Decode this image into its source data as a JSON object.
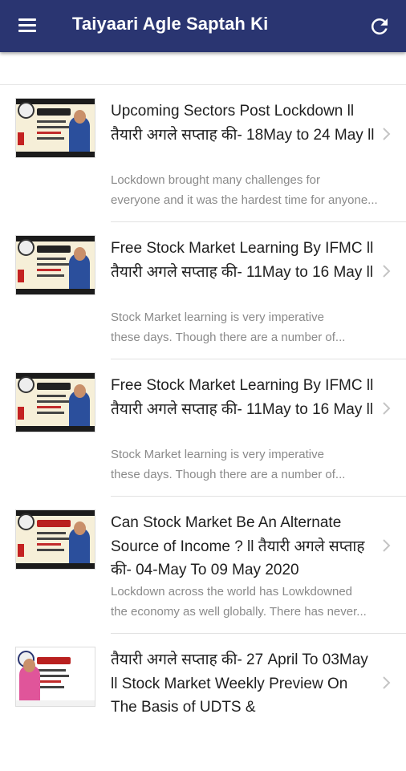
{
  "appbar": {
    "title": "Taiyaari Agle Saptah Ki",
    "menu_icon": "menu-icon",
    "refresh_icon": "refresh-icon",
    "color": "#2a3571"
  },
  "posts": [
    {
      "title": "Upcoming Sectors Post Lockdown ll तैयारी अगले सप्ताह की- 18May to 24 May ll",
      "desc_line1": "Lockdown brought many challenges for",
      "desc_line2": "everyone and it was the hardest time for anyone...",
      "thumb_icon": "video-thumbnail-icon"
    },
    {
      "title": "Free Stock Market Learning By IFMC ll तैयारी अगले सप्ताह की- 11May to 16 May ll",
      "desc_line1": "Stock Market learning is very imperative",
      "desc_line2": "these days. Though there are a number of...",
      "thumb_icon": "video-thumbnail-icon"
    },
    {
      "title": "Free Stock Market Learning By IFMC ll तैयारी अगले सप्ताह की- 11May to 16 May ll",
      "desc_line1": "Stock Market learning is very imperative",
      "desc_line2": "these days. Though there are a number of...",
      "thumb_icon": "video-thumbnail-icon"
    },
    {
      "title": "Can Stock Market Be An Alternate Source of Income ? ll तैयारी अगले सप्ताह की- 04-May To 09 May 2020",
      "desc_line1": "Lockdown across the world has Lowkdowned",
      "desc_line2": "the economy as well globally. There has never...",
      "thumb_icon": "video-thumbnail-icon"
    },
    {
      "title": "तैयारी अगले सप्ताह की- 27 April To 03May ll Stock Market Weekly Preview On The Basis of UDTS &",
      "desc_line1": "",
      "desc_line2": "",
      "thumb_icon": "video-thumbnail-icon"
    }
  ]
}
